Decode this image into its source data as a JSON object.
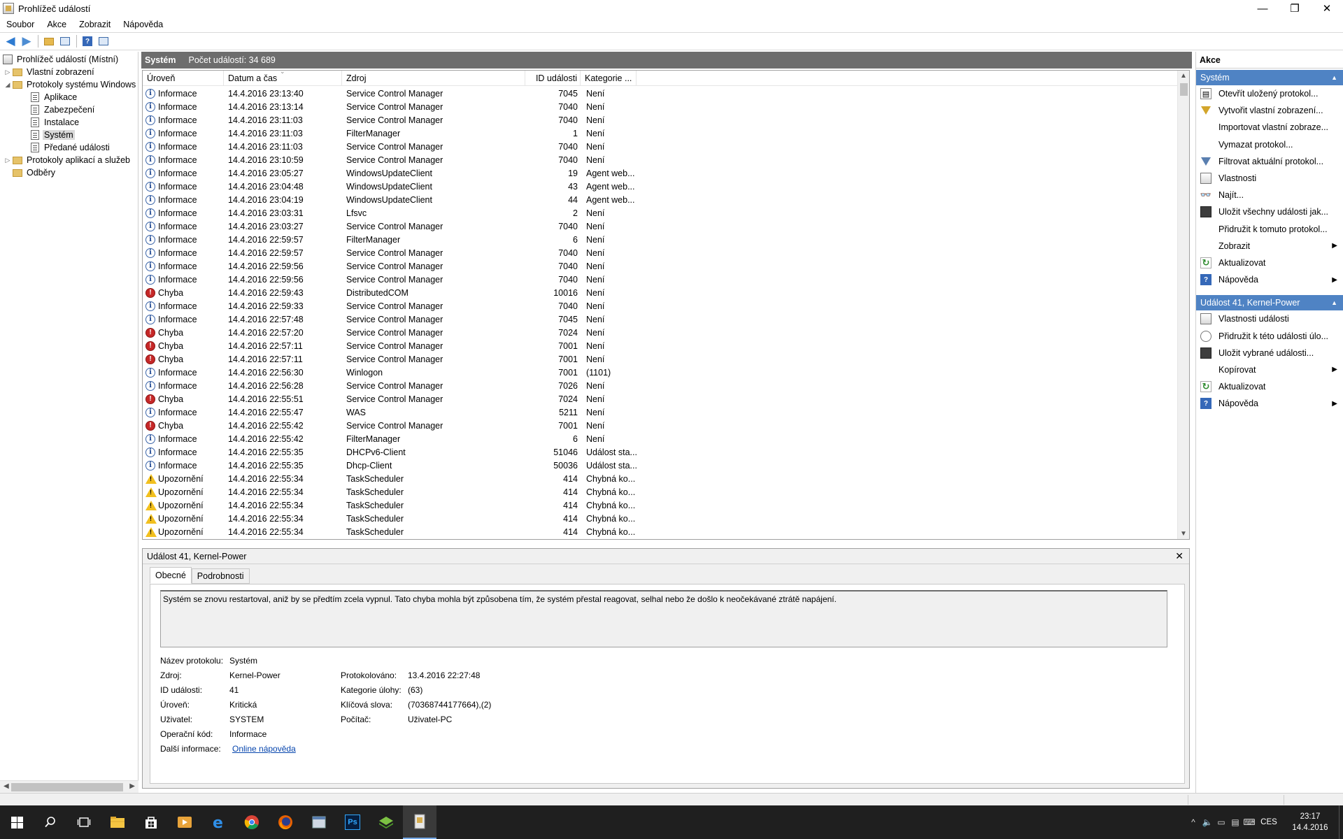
{
  "window": {
    "title": "Prohlížeč událostí",
    "min": "—",
    "restore": "❐",
    "close": "✕"
  },
  "menu": [
    "Soubor",
    "Akce",
    "Zobrazit",
    "Nápověda"
  ],
  "tree": {
    "root": "Prohlížeč událostí (Místní)",
    "custom_views": "Vlastní zobrazení",
    "windows_logs": "Protokoly systému Windows",
    "logs": [
      "Aplikace",
      "Zabezpečení",
      "Instalace",
      "Systém",
      "Předané události"
    ],
    "selected": "Systém",
    "app_service_logs": "Protokoly aplikací a služeb",
    "subscriptions": "Odběry"
  },
  "list": {
    "log_name": "Systém",
    "event_count": "Počet událostí: 34 689",
    "columns": [
      "Úroveň",
      "Datum a čas",
      "Zdroj",
      "ID události",
      "Kategorie ..."
    ],
    "rows": [
      {
        "level": "info",
        "level_label": "Informace",
        "date": "14.4.2016 23:13:40",
        "source": "Service Control Manager",
        "id": "7045",
        "category": "Není"
      },
      {
        "level": "info",
        "level_label": "Informace",
        "date": "14.4.2016 23:13:14",
        "source": "Service Control Manager",
        "id": "7040",
        "category": "Není"
      },
      {
        "level": "info",
        "level_label": "Informace",
        "date": "14.4.2016 23:11:03",
        "source": "Service Control Manager",
        "id": "7040",
        "category": "Není"
      },
      {
        "level": "info",
        "level_label": "Informace",
        "date": "14.4.2016 23:11:03",
        "source": "FilterManager",
        "id": "1",
        "category": "Není"
      },
      {
        "level": "info",
        "level_label": "Informace",
        "date": "14.4.2016 23:11:03",
        "source": "Service Control Manager",
        "id": "7040",
        "category": "Není"
      },
      {
        "level": "info",
        "level_label": "Informace",
        "date": "14.4.2016 23:10:59",
        "source": "Service Control Manager",
        "id": "7040",
        "category": "Není"
      },
      {
        "level": "info",
        "level_label": "Informace",
        "date": "14.4.2016 23:05:27",
        "source": "WindowsUpdateClient",
        "id": "19",
        "category": "Agent web..."
      },
      {
        "level": "info",
        "level_label": "Informace",
        "date": "14.4.2016 23:04:48",
        "source": "WindowsUpdateClient",
        "id": "43",
        "category": "Agent web..."
      },
      {
        "level": "info",
        "level_label": "Informace",
        "date": "14.4.2016 23:04:19",
        "source": "WindowsUpdateClient",
        "id": "44",
        "category": "Agent web..."
      },
      {
        "level": "info",
        "level_label": "Informace",
        "date": "14.4.2016 23:03:31",
        "source": "Lfsvc",
        "id": "2",
        "category": "Není"
      },
      {
        "level": "info",
        "level_label": "Informace",
        "date": "14.4.2016 23:03:27",
        "source": "Service Control Manager",
        "id": "7040",
        "category": "Není"
      },
      {
        "level": "info",
        "level_label": "Informace",
        "date": "14.4.2016 22:59:57",
        "source": "FilterManager",
        "id": "6",
        "category": "Není"
      },
      {
        "level": "info",
        "level_label": "Informace",
        "date": "14.4.2016 22:59:57",
        "source": "Service Control Manager",
        "id": "7040",
        "category": "Není"
      },
      {
        "level": "info",
        "level_label": "Informace",
        "date": "14.4.2016 22:59:56",
        "source": "Service Control Manager",
        "id": "7040",
        "category": "Není"
      },
      {
        "level": "info",
        "level_label": "Informace",
        "date": "14.4.2016 22:59:56",
        "source": "Service Control Manager",
        "id": "7040",
        "category": "Není"
      },
      {
        "level": "error",
        "level_label": "Chyba",
        "date": "14.4.2016 22:59:43",
        "source": "DistributedCOM",
        "id": "10016",
        "category": "Není"
      },
      {
        "level": "info",
        "level_label": "Informace",
        "date": "14.4.2016 22:59:33",
        "source": "Service Control Manager",
        "id": "7040",
        "category": "Není"
      },
      {
        "level": "info",
        "level_label": "Informace",
        "date": "14.4.2016 22:57:48",
        "source": "Service Control Manager",
        "id": "7045",
        "category": "Není"
      },
      {
        "level": "error",
        "level_label": "Chyba",
        "date": "14.4.2016 22:57:20",
        "source": "Service Control Manager",
        "id": "7024",
        "category": "Není"
      },
      {
        "level": "error",
        "level_label": "Chyba",
        "date": "14.4.2016 22:57:11",
        "source": "Service Control Manager",
        "id": "7001",
        "category": "Není"
      },
      {
        "level": "error",
        "level_label": "Chyba",
        "date": "14.4.2016 22:57:11",
        "source": "Service Control Manager",
        "id": "7001",
        "category": "Není"
      },
      {
        "level": "info",
        "level_label": "Informace",
        "date": "14.4.2016 22:56:30",
        "source": "Winlogon",
        "id": "7001",
        "category": "(1101)"
      },
      {
        "level": "info",
        "level_label": "Informace",
        "date": "14.4.2016 22:56:28",
        "source": "Service Control Manager",
        "id": "7026",
        "category": "Není"
      },
      {
        "level": "error",
        "level_label": "Chyba",
        "date": "14.4.2016 22:55:51",
        "source": "Service Control Manager",
        "id": "7024",
        "category": "Není"
      },
      {
        "level": "info",
        "level_label": "Informace",
        "date": "14.4.2016 22:55:47",
        "source": "WAS",
        "id": "5211",
        "category": "Není"
      },
      {
        "level": "error",
        "level_label": "Chyba",
        "date": "14.4.2016 22:55:42",
        "source": "Service Control Manager",
        "id": "7001",
        "category": "Není"
      },
      {
        "level": "info",
        "level_label": "Informace",
        "date": "14.4.2016 22:55:42",
        "source": "FilterManager",
        "id": "6",
        "category": "Není"
      },
      {
        "level": "info",
        "level_label": "Informace",
        "date": "14.4.2016 22:55:35",
        "source": "DHCPv6-Client",
        "id": "51046",
        "category": "Událost sta..."
      },
      {
        "level": "info",
        "level_label": "Informace",
        "date": "14.4.2016 22:55:35",
        "source": "Dhcp-Client",
        "id": "50036",
        "category": "Událost sta..."
      },
      {
        "level": "warn",
        "level_label": "Upozornění",
        "date": "14.4.2016 22:55:34",
        "source": "TaskScheduler",
        "id": "414",
        "category": "Chybná ko..."
      },
      {
        "level": "warn",
        "level_label": "Upozornění",
        "date": "14.4.2016 22:55:34",
        "source": "TaskScheduler",
        "id": "414",
        "category": "Chybná ko..."
      },
      {
        "level": "warn",
        "level_label": "Upozornění",
        "date": "14.4.2016 22:55:34",
        "source": "TaskScheduler",
        "id": "414",
        "category": "Chybná ko..."
      },
      {
        "level": "warn",
        "level_label": "Upozornění",
        "date": "14.4.2016 22:55:34",
        "source": "TaskScheduler",
        "id": "414",
        "category": "Chybná ko..."
      },
      {
        "level": "warn",
        "level_label": "Upozornění",
        "date": "14.4.2016 22:55:34",
        "source": "TaskScheduler",
        "id": "414",
        "category": "Chybná ko..."
      }
    ]
  },
  "detail": {
    "title": "Událost 41, Kernel-Power",
    "close": "✕",
    "tabs": [
      "Obecné",
      "Podrobnosti"
    ],
    "description": "Systém se znovu restartoval, aniž by se předtím zcela vypnul. Tato chyba mohla být způsobena tím, že systém přestal reagovat, selhal nebo že došlo k neočekávané ztrátě napájení.",
    "labels": {
      "log_name": "Název protokolu:",
      "source": "Zdroj:",
      "event_id": "ID události:",
      "level": "Úroveň:",
      "user": "Uživatel:",
      "opcode": "Operační kód:",
      "more_info": "Další informace:",
      "logged": "Protokolováno:",
      "task_category": "Kategorie úlohy:",
      "keywords": "Klíčová slova:",
      "computer": "Počítač:"
    },
    "values": {
      "log_name": "Systém",
      "source": "Kernel-Power",
      "event_id": "41",
      "level": "Kritická",
      "user": "SYSTEM",
      "opcode": "Informace",
      "more_info": "Online nápověda",
      "logged": "13.4.2016 22:27:48",
      "task_category": "(63)",
      "keywords": "(70368744177664),(2)",
      "computer": "Uživatel-PC"
    }
  },
  "actions": {
    "header": "Akce",
    "section1": "Systém",
    "items1": [
      {
        "icon": "open-log-icon",
        "label": "Otevřít uložený protokol..."
      },
      {
        "icon": "filter-create-icon",
        "label": "Vytvořit vlastní zobrazení..."
      },
      {
        "icon": "",
        "label": "Importovat vlastní zobraze..."
      },
      {
        "icon": "",
        "label": "Vymazat protokol..."
      },
      {
        "icon": "filter-icon",
        "label": "Filtrovat aktuální protokol..."
      },
      {
        "icon": "properties-icon",
        "label": "Vlastnosti"
      },
      {
        "icon": "find-icon",
        "label": "Najít..."
      },
      {
        "icon": "save-icon",
        "label": "Uložit všechny události jak..."
      },
      {
        "icon": "",
        "label": "Přidružit k tomuto protokol..."
      },
      {
        "icon": "",
        "label": "Zobrazit",
        "submenu": true
      },
      {
        "icon": "refresh-icon",
        "label": "Aktualizovat"
      },
      {
        "icon": "help-icon",
        "label": "Nápověda",
        "submenu": true
      }
    ],
    "section2": "Událost 41, Kernel-Power",
    "items2": [
      {
        "icon": "properties-icon",
        "label": "Vlastnosti události"
      },
      {
        "icon": "task-icon",
        "label": "Přidružit k této události úlo..."
      },
      {
        "icon": "save-icon",
        "label": "Uložit vybrané události..."
      },
      {
        "icon": "",
        "label": "Kopírovat",
        "submenu": true
      },
      {
        "icon": "refresh-icon",
        "label": "Aktualizovat"
      },
      {
        "icon": "help-icon",
        "label": "Nápověda",
        "submenu": true
      }
    ]
  },
  "taskbar": {
    "apps": [
      "start-icon",
      "search-icon",
      "task-view-icon",
      "file-explorer-icon",
      "store-icon",
      "media-player-icon",
      "edge-icon",
      "chrome-icon",
      "firefox-icon",
      "app-window-icon",
      "photoshop-icon",
      "app-green-icon",
      "event-viewer-icon"
    ],
    "ps_label": "Ps",
    "lang": "CES",
    "time": "23:17",
    "date": "14.4.2016"
  }
}
